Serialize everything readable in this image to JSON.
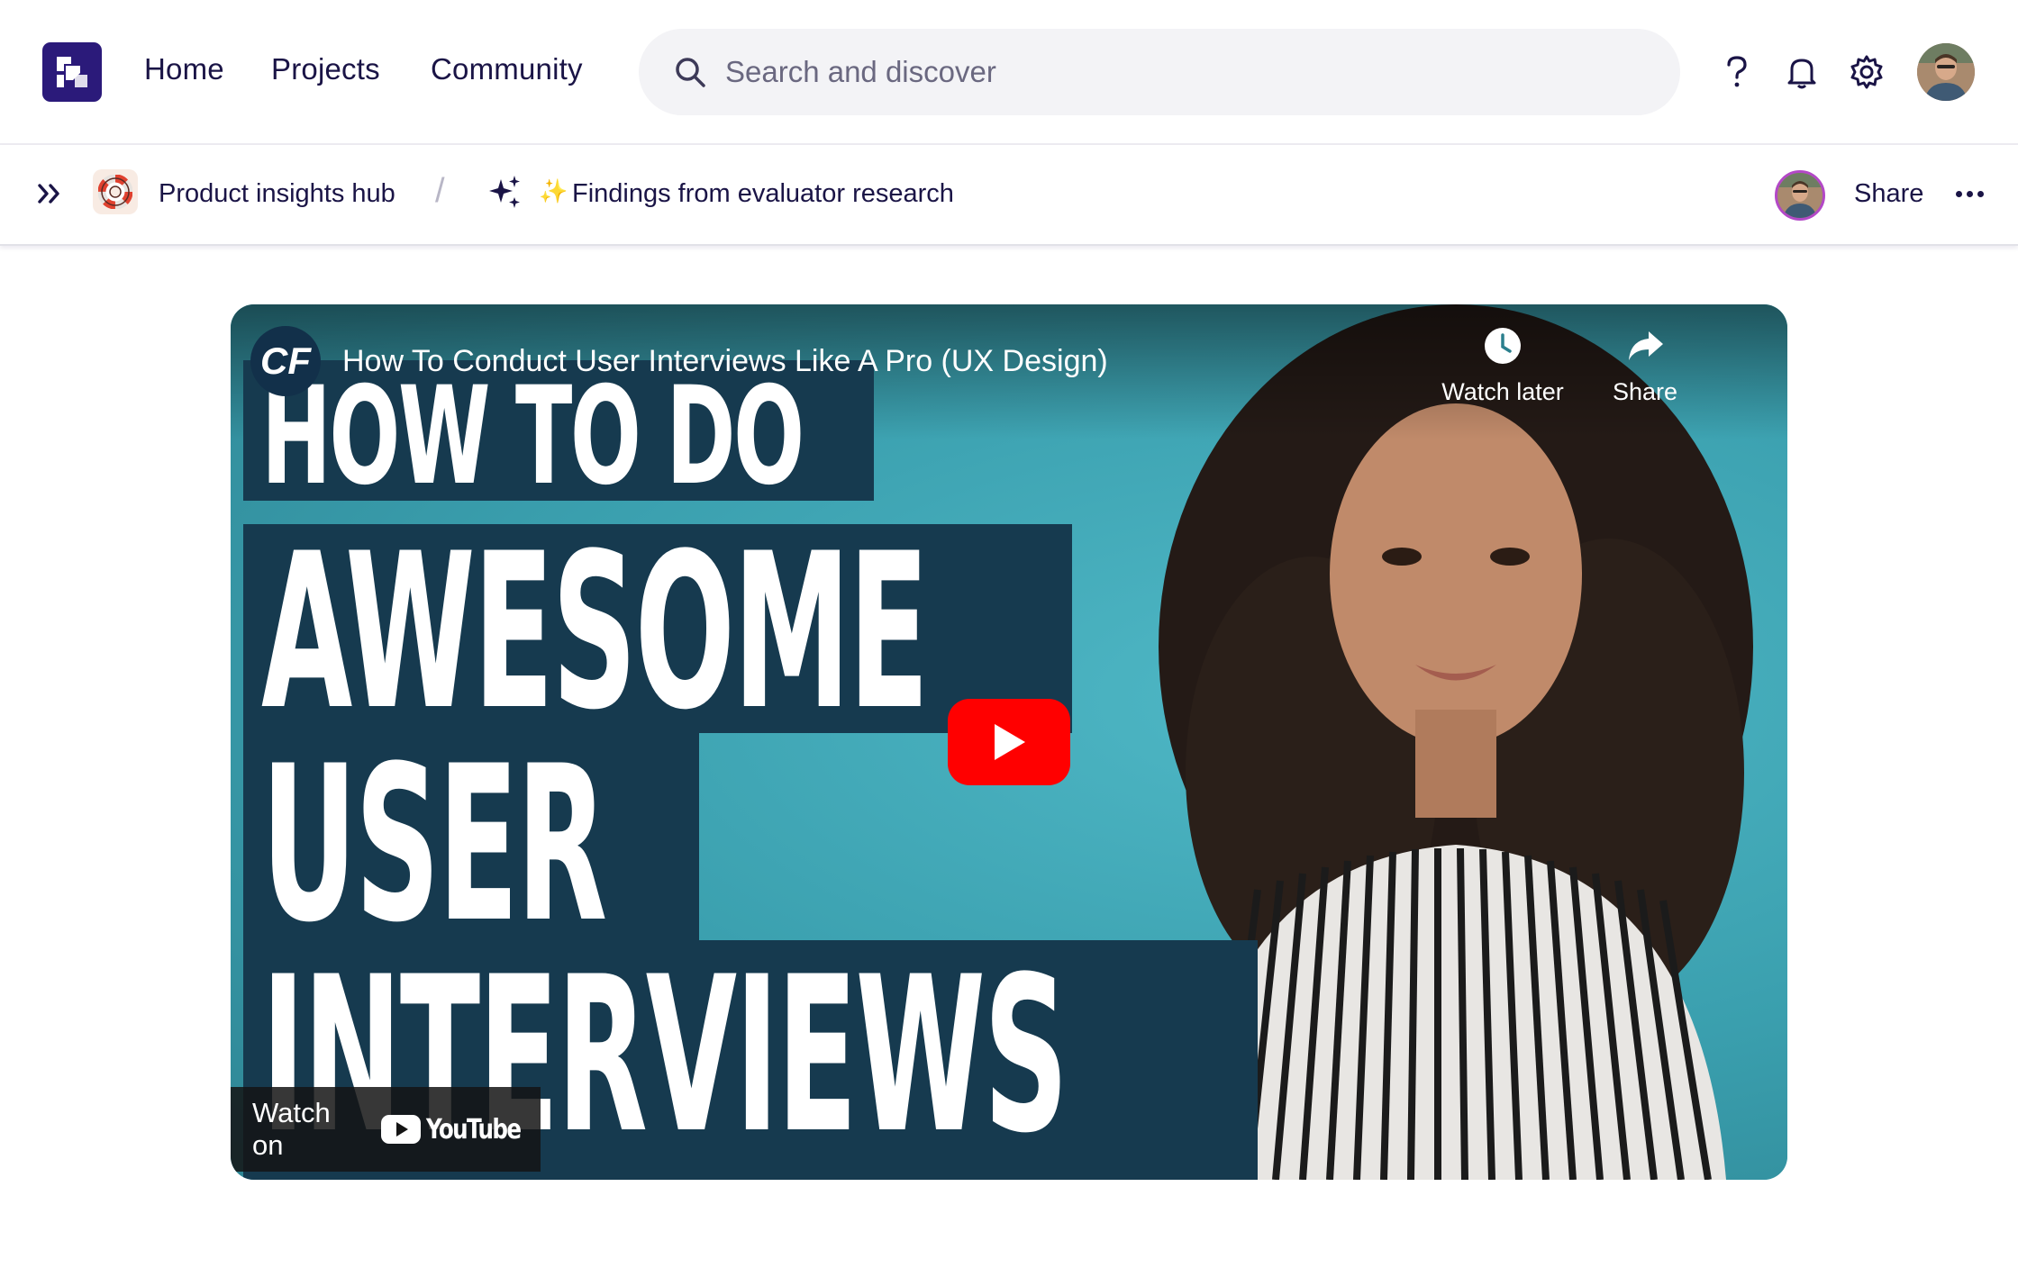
{
  "nav": {
    "links": [
      "Home",
      "Projects",
      "Community"
    ],
    "search_placeholder": "Search and discover"
  },
  "breadcrumb": {
    "hub_label": "Product insights hub",
    "separator": "/",
    "page_prefix": "✨",
    "page_label": "Findings from evaluator research",
    "share_label": "Share"
  },
  "video": {
    "channel_initials": "CF",
    "title": "How To Conduct User Interviews Like A Pro (UX Design)",
    "watch_later_label": "Watch later",
    "share_label": "Share",
    "thumbnail_lines": [
      "HOW TO DO",
      "AWESOME",
      "USER",
      "INTERVIEWS"
    ],
    "watch_on_label": "Watch on",
    "youtube_wordmark": "YouTube"
  },
  "colors": {
    "brand": "#2b1a7a",
    "text": "#1a1446",
    "video_bg": "#3aa3b3",
    "thumb_block": "#163a4f",
    "play_red": "#ff0000",
    "avatar_ring": "#b348c7"
  }
}
